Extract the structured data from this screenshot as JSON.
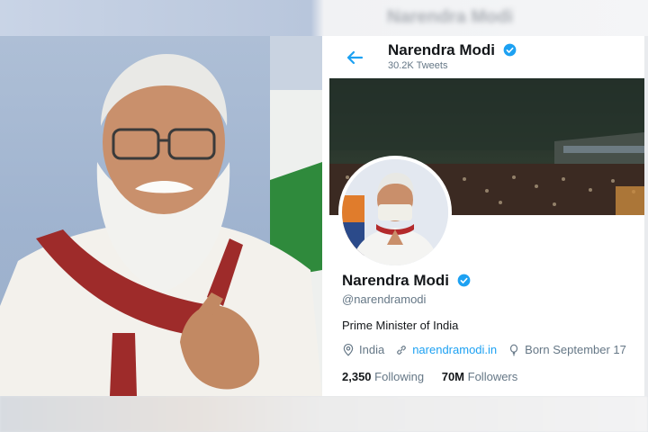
{
  "profile": {
    "name": "Narendra Modi",
    "tweet_count": "30.2K Tweets",
    "handle": "@narendramodi",
    "bio": "Prime Minister of India",
    "location": "India",
    "website": "narendramodi.in",
    "born": "Born September 17",
    "following_count": "2,350",
    "following_label": "Following",
    "followers_count": "70M",
    "followers_label": "Followers",
    "verified": true
  },
  "colors": {
    "accent": "#1da1f2",
    "text_primary": "#14171a",
    "text_secondary": "#657786"
  },
  "icons": [
    "back-arrow-icon",
    "verified-badge-icon",
    "location-pin-icon",
    "link-icon",
    "balloon-icon"
  ]
}
